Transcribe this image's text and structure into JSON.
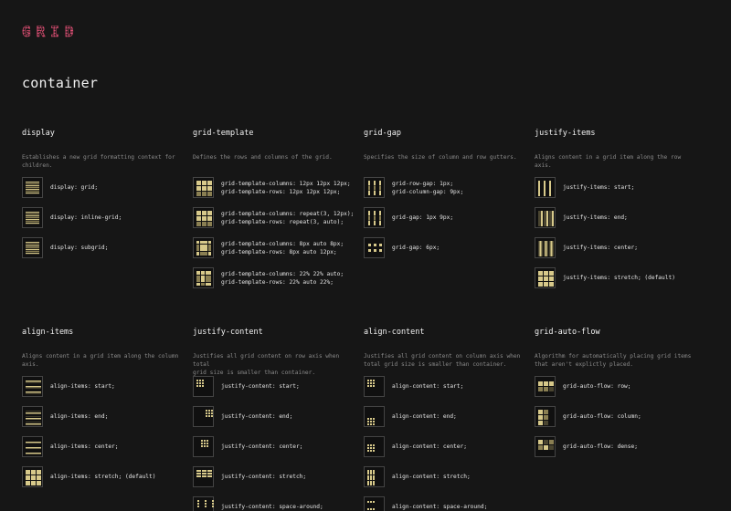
{
  "logo": [
    "G",
    "R",
    "I",
    "D"
  ],
  "section_title": "container",
  "colors": {
    "background": "#161616",
    "accent": "#d7c98a",
    "logo": "#d14b6a",
    "text": "#e6e6e6",
    "muted": "#8a8a8a"
  },
  "columns_top": [
    {
      "title": "display",
      "desc": "Establishes a new grid formatting context for\nchildren.",
      "rows": [
        {
          "icon": "display-grid-icon",
          "code": "display: grid;"
        },
        {
          "icon": "display-inline-grid-icon",
          "code": "display: inline-grid;"
        },
        {
          "icon": "display-subgrid-icon",
          "code": "display: subgrid;"
        }
      ]
    },
    {
      "title": "grid-template",
      "desc": "Defines the rows and columns of the grid.",
      "rows": [
        {
          "icon": "grid-template-fixed-icon",
          "code": "grid-template-columns: 12px 12px 12px;\ngrid-template-rows: 12px 12px 12px;"
        },
        {
          "icon": "grid-template-repeat-icon",
          "code": "grid-template-columns: repeat(3, 12px);\ngrid-template-rows: repeat(3, auto);"
        },
        {
          "icon": "grid-template-auto-icon",
          "code": "grid-template-columns: 8px auto 8px;\ngrid-template-rows: 8px auto 12px;"
        },
        {
          "icon": "grid-template-percent-icon",
          "code": "grid-template-columns: 22% 22% auto;\ngrid-template-rows: 22% auto 22%;"
        }
      ]
    },
    {
      "title": "grid-gap",
      "desc": "Specifies the size of column and row gutters.",
      "rows": [
        {
          "icon": "grid-gap-row-column-icon",
          "code": "grid-row-gap: 1px;\ngrid-column-gap: 9px;"
        },
        {
          "icon": "grid-gap-two-value-icon",
          "code": "grid-gap: 1px 9px;"
        },
        {
          "icon": "grid-gap-single-icon",
          "code": "grid-gap: 6px;"
        }
      ]
    },
    {
      "title": "justify-items",
      "desc": "Aligns content in a grid item along the row axis.",
      "rows": [
        {
          "icon": "justify-items-start-icon",
          "code": "justify-items: start;"
        },
        {
          "icon": "justify-items-end-icon",
          "code": "justify-items: end;"
        },
        {
          "icon": "justify-items-center-icon",
          "code": "justify-items: center;"
        },
        {
          "icon": "justify-items-stretch-icon",
          "code": "justify-items: stretch; (default)"
        }
      ]
    }
  ],
  "columns_bottom": [
    {
      "title": "align-items",
      "desc": "Aligns content in a grid item along the column\naxis.",
      "rows": [
        {
          "icon": "align-items-start-icon",
          "code": "align-items: start;"
        },
        {
          "icon": "align-items-end-icon",
          "code": "align-items: end;"
        },
        {
          "icon": "align-items-center-icon",
          "code": "align-items: center;"
        },
        {
          "icon": "align-items-stretch-icon",
          "code": "align-items: stretch; (default)"
        }
      ]
    },
    {
      "title": "justify-content",
      "desc": "Justifies all grid content on row axis when total\ngrid size is smaller than container.",
      "rows": [
        {
          "icon": "justify-content-start-icon",
          "code": "justify-content: start;"
        },
        {
          "icon": "justify-content-end-icon",
          "code": "justify-content: end;"
        },
        {
          "icon": "justify-content-center-icon",
          "code": "justify-content: center;"
        },
        {
          "icon": "justify-content-stretch-icon",
          "code": "justify-content: stretch;"
        },
        {
          "icon": "justify-content-space-around-icon",
          "code": "justify-content: space-around;"
        }
      ]
    },
    {
      "title": "align-content",
      "desc": "Justifies all grid content on column axis when\ntotal grid size is smaller than container.",
      "rows": [
        {
          "icon": "align-content-start-icon",
          "code": "align-content: start;"
        },
        {
          "icon": "align-content-end-icon",
          "code": "align-content: end;"
        },
        {
          "icon": "align-content-center-icon",
          "code": "align-content: center;"
        },
        {
          "icon": "align-content-stretch-icon",
          "code": "align-content: stretch;"
        },
        {
          "icon": "align-content-space-around-icon",
          "code": "align-content: space-around;"
        }
      ]
    },
    {
      "title": "grid-auto-flow",
      "desc": "Algorithm for automatically placing grid items\nthat aren't explictly placed.",
      "rows": [
        {
          "icon": "grid-auto-flow-row-icon",
          "code": "grid-auto-flow: row;"
        },
        {
          "icon": "grid-auto-flow-column-icon",
          "code": "grid-auto-flow: column;"
        },
        {
          "icon": "grid-auto-flow-dense-icon",
          "code": "grid-auto-flow: dense;"
        }
      ]
    }
  ]
}
